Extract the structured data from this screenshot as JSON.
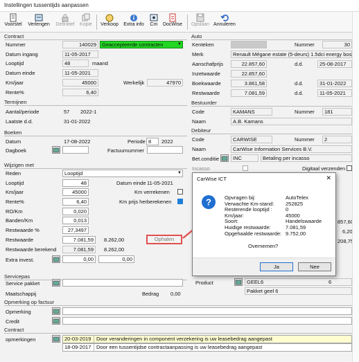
{
  "window": {
    "title": "Instellingen tussentijds aanpassen"
  },
  "toolbar": {
    "voorstel": "Voorstel",
    "verlengen": "Verlengen",
    "definitief": "Definitief",
    "kopie": "Kopie",
    "verkoop": "Verkoop",
    "extra_info": "Extra info",
    "cm": "Cm",
    "docwise": "DocWise",
    "opslaan": "Opslaan",
    "annuleren": "Annuleren"
  },
  "contract": {
    "section": "Contract",
    "nummer_label": "Nummer",
    "nummer": "140029",
    "status": "Geaccepteerde contracten",
    "datum_ingang_label": "Datum ingang",
    "datum_ingang": "11-05-2017",
    "looptijd_label": "Looptijd",
    "looptijd": "48",
    "looptijd_unit": "maand",
    "datum_einde_label": "Datum einde",
    "datum_einde": "11-05-2021",
    "kmjaar_label": "Km/jaar",
    "kmjaar": "45000",
    "werkelijk_label": "Werkelijk",
    "werkelijk": "47970",
    "rente_label": "Rente%",
    "rente": "6,40"
  },
  "termijnen": {
    "section": "Termijnen",
    "aantal_label": "Aantal/periode",
    "aantal": "57",
    "periode": "2022-1",
    "laatste_label": "Laatste d.d.",
    "laatste": "31-01-2022"
  },
  "boeken": {
    "section": "Boeken",
    "datum_label": "Datum",
    "datum": "17-08-2022",
    "periode_label": "Periode",
    "periode_nr": "8",
    "periode_jaar": "2022",
    "dagboek_label": "Dagboek",
    "factuurnummer_label": "Factuurnummer"
  },
  "wijzigen": {
    "section": "Wijzigen met",
    "reden_label": "Reden",
    "reden": "Looptijd",
    "looptijd_label": "Looptijd",
    "looptijd": "48",
    "datum_einde_label": "Datum einde",
    "datum_einde": "11-05-2021",
    "kmjaar_label": "Km/jaar",
    "kmjaar": "45000",
    "km_verrekenen_label": "Km verrekenen",
    "rente_label": "Rente%",
    "rente": "6,40",
    "km_prijs_label": "Km prijs herberekenen",
    "ro_label": "RO/Km",
    "ro": "0,020",
    "banden_label": "Banden/Km",
    "banden": "0,013",
    "restwaarde_pct_label": "Restwaarde %",
    "restwaarde_pct": "27,3497",
    "restwaarde_label": "Restwaarde",
    "restwaarde": "7.081,59",
    "restwaarde_new": "8.262,00",
    "restwaarde_ber_label": "Restwaarde berekend",
    "restwaarde_ber": "7.081,59",
    "restwaarde_ber_new": "8.262,00",
    "extra_label": "Extra invest.",
    "extra_1": "0,00",
    "extra_2": "0,00",
    "ophalen_label": "Ophalen"
  },
  "servicepas": {
    "section": "Servicepas",
    "service_pakket_label": "Service pakket",
    "maatschappij_label": "Maatschappij",
    "bedrag_label": "Bedrag",
    "bedrag": "0,00"
  },
  "factuur": {
    "section": "Opmerking op factuur",
    "opmerking_label": "Opmerking",
    "credit_label": "Credit"
  },
  "contract_notes": {
    "section": "Contract",
    "opmerkingen_label": "opmerkingen",
    "rows": [
      {
        "date": "20-03-2019",
        "text": "Door veranderingen in component verzekering is uw leasebedrag aangepast"
      },
      {
        "date": "18-09-2017",
        "text": "Door een tussentijdse contractaanpassing is uw leasebedrag aangepast"
      }
    ]
  },
  "auto": {
    "section": "Auto",
    "kenteken_label": "Kenteken",
    "nummer_label": "Nummer",
    "nummer": "30",
    "merk_label": "Merk",
    "merk": "Renault Mégane estate (5-deurs) 1.5dci energy bose 81",
    "aanschaf_label": "Aanschafprijs",
    "aanschaf": "22.857,60",
    "dd_label": "d.d.",
    "aanschaf_dd": "25-08-2017",
    "inzet_label": "Inzetwaarde",
    "inzet": "22.857,60",
    "boek_label": "Boekwaarde",
    "boek": "3.861,58",
    "boek_dd": "31-01-2022",
    "rest_label": "Restwaarde",
    "rest": "7.081,59",
    "rest_dd": "11-05-2021"
  },
  "bestuurder": {
    "section": "Bestuurder",
    "code_label": "Code",
    "code": "KAMANS",
    "nummer_label": "Nummer",
    "nummer": "181",
    "naam_label": "Naam",
    "naam": "A.B. Kamans"
  },
  "debiteur": {
    "section": "Debiteur",
    "code_label": "Code",
    "code": "CARWISE",
    "nummer_label": "Nummer",
    "nummer": "2",
    "naam_label": "Naam",
    "naam": "CarWise Information Services B.V.",
    "betconditie_label": "Bet.conditie",
    "betconditie": "INC",
    "betconditie_desc": "Betaling per incasso",
    "incasso_label": "Incasso",
    "digitaal_label": "Digitaal verzenden"
  },
  "right_partial": {
    "val1": "857,60",
    "val2": "6,20",
    "val3": "208,75"
  },
  "product": {
    "label": "Product",
    "code": "GEEL6",
    "nr": "6",
    "desc": "Pakket geel 6"
  },
  "dialog": {
    "title": "CarWise ICT",
    "close": "✕",
    "rows": [
      {
        "k": "Opvragen bij:",
        "v": "AutoTelex"
      },
      {
        "k": "Verwachte Km-stand:",
        "v": "252825"
      },
      {
        "k": "Resterende looptijd :",
        "v": "0"
      },
      {
        "k": "Km/jaar:",
        "v": "45000"
      },
      {
        "k": "Soort:",
        "v": "Handelswaarde"
      },
      {
        "k": "Huidige restwaarde:",
        "v": "7.081,59"
      },
      {
        "k": "Opgehaalde restwaarde:",
        "v": "9.752,00"
      }
    ],
    "question": "Overnemen?",
    "ja": "Ja",
    "nee": "Nee"
  },
  "colors": {
    "status_green": "#22d622",
    "ophalen_border": "#e05050",
    "question_icon": "#1f6fd0"
  }
}
